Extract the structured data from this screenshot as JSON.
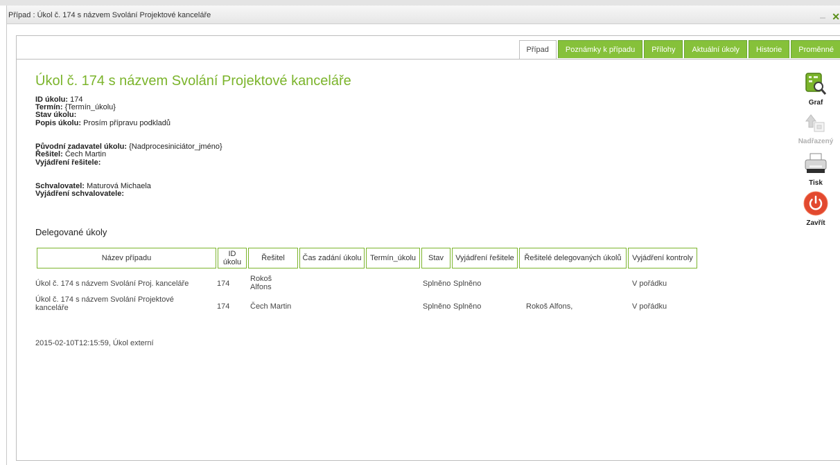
{
  "window": {
    "title": "Případ : Úkol č. 174 s názvem Svolání Projektové kanceláře",
    "close_label": "✕"
  },
  "tabs": [
    {
      "label": "Případ",
      "active": true
    },
    {
      "label": "Poznámky k případu",
      "active": false
    },
    {
      "label": "Přílohy",
      "active": false
    },
    {
      "label": "Aktuální úkoly",
      "active": false
    },
    {
      "label": "Historie",
      "active": false
    },
    {
      "label": "Proměnné",
      "active": false
    }
  ],
  "task": {
    "heading": "Úkol č. 174 s názvem Svolání Projektové kanceláře",
    "fields": [
      {
        "label": "ID úkolu:",
        "value": "174"
      },
      {
        "label": "Termín:",
        "value": "{Termín_úkolu}"
      },
      {
        "label": "Stav úkolu:",
        "value": ""
      },
      {
        "label": "Popis úkolu:",
        "value": "Prosím přípravu podkladů"
      },
      {
        "label": "Původní zadavatel úkolu:",
        "value": "{Nadprocesiniciátor_jméno}"
      },
      {
        "label": "Řešitel:",
        "value": "Čech Martin"
      },
      {
        "label": "Vyjádření řešitele:",
        "value": ""
      },
      {
        "label": "Schvalovatel:",
        "value": "Maturová Michaela"
      },
      {
        "label": "Vyjádření schvalovatele:",
        "value": ""
      }
    ]
  },
  "delegated": {
    "title": "Delegované úkoly",
    "columns": [
      "Název případu",
      "ID úkolu",
      "Řešitel",
      "Čas zadání úkolu",
      "Termín_úkolu",
      "Stav",
      "Vyjádření řešitele",
      "Řešitelé delegovaných úkolů",
      "Vyjádření kontroly"
    ],
    "rows": [
      {
        "name": "Úkol č. 174 s názvem Svolání Proj. kanceláře",
        "id": "174",
        "resitel": "Rokoš Alfons",
        "cas": "",
        "termin": "",
        "stav": "Splněno",
        "vyjadreni": "Splněno",
        "delegovani": "",
        "kontrola": "V pořádku"
      },
      {
        "name": "Úkol č. 174 s názvem Svolání Projektové kanceláře",
        "id": "174",
        "resitel": "Čech Martin",
        "cas": "",
        "termin": "",
        "stav": "Splněno",
        "vyjadreni": "Splněno",
        "delegovani": "Rokoš Alfons,",
        "kontrola": "V pořádku"
      }
    ]
  },
  "footer_note": "2015-02-10T12:15:59, Úkol externí",
  "sidebar": [
    {
      "label": "Graf",
      "icon": "graph-icon",
      "enabled": true
    },
    {
      "label": "Nadřazený",
      "icon": "parent-up-icon",
      "enabled": false
    },
    {
      "label": "Tisk",
      "icon": "printer-icon",
      "enabled": true
    },
    {
      "label": "Zavřít",
      "icon": "power-icon",
      "enabled": true
    }
  ],
  "colors": {
    "accent": "#7bb42b",
    "tab_green": "#86c13a",
    "close_red": "#e2492f"
  }
}
